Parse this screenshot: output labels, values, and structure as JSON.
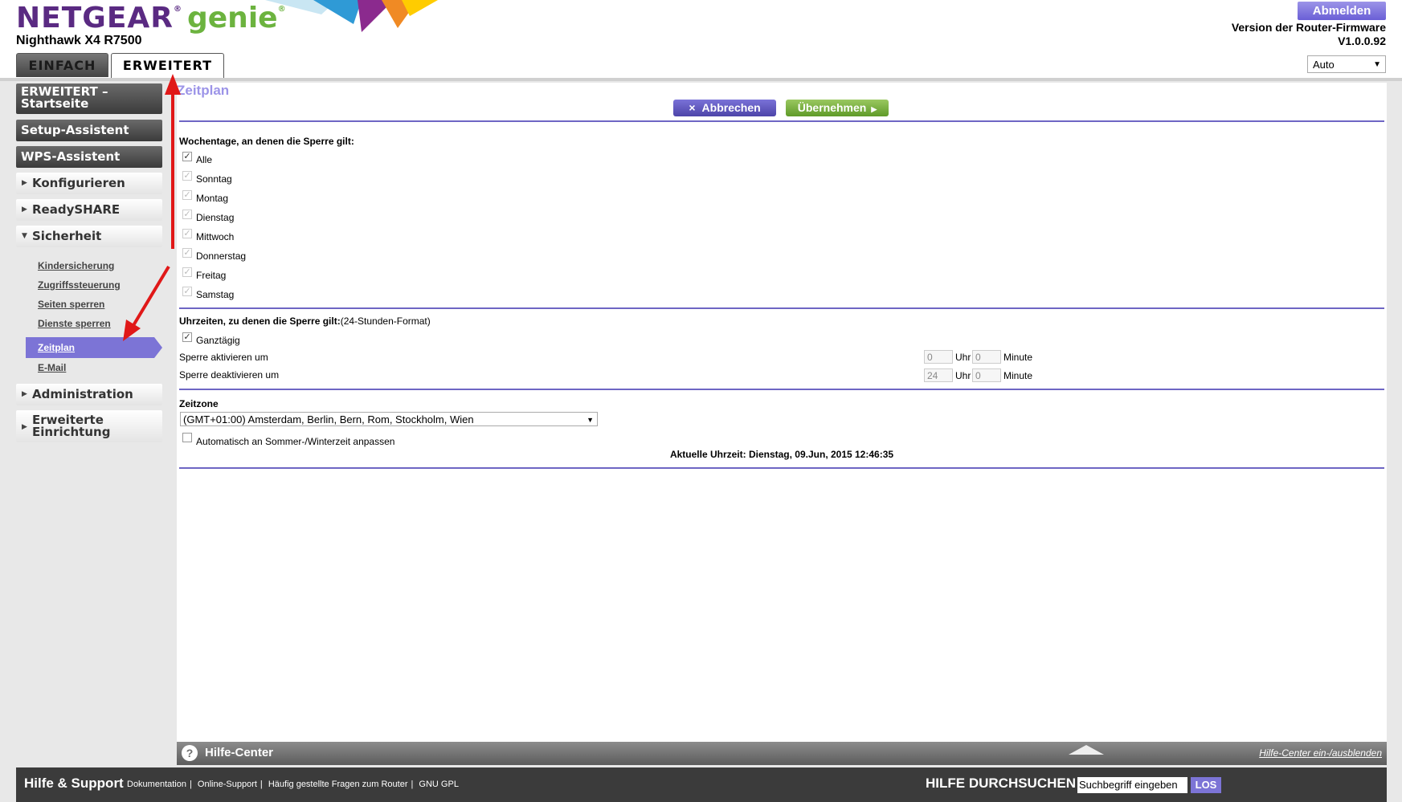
{
  "header": {
    "brand": "NETGEAR",
    "brand_sub": "genie",
    "model": "Nighthawk X4 R7500",
    "logout_label": "Abmelden",
    "firmware_label": "Version der Router-Firmware",
    "firmware_version": "V1.0.0.92",
    "language": "Auto",
    "tabs": [
      {
        "label": "EINFACH",
        "active": false
      },
      {
        "label": "ERWEITERT",
        "active": true
      }
    ]
  },
  "sidebar": {
    "dark_items": [
      {
        "label_line1": "ERWEITERT –",
        "label_line2": "Startseite"
      },
      {
        "label": "Setup-Assistent"
      },
      {
        "label": "WPS-Assistent"
      }
    ],
    "sections": [
      {
        "label": "Konfigurieren",
        "expanded": false
      },
      {
        "label": "ReadySHARE",
        "expanded": false
      },
      {
        "label": "Sicherheit",
        "expanded": true
      },
      {
        "label": "Administration",
        "expanded": false
      },
      {
        "label_line1": "Erweiterte",
        "label_line2": "Einrichtung",
        "expanded": false
      }
    ],
    "security_links": [
      "Kindersicherung",
      "Zugriffssteuerung",
      "Seiten sperren",
      "Dienste sperren",
      "Zeitplan",
      "E-Mail"
    ],
    "active_link": "Zeitplan"
  },
  "content": {
    "title": "Zeitplan",
    "cancel_label": "Abbrechen",
    "apply_label": "Übernehmen",
    "days_heading": "Wochentage, an denen die Sperre gilt:",
    "days": [
      {
        "label": "Alle",
        "checked": true,
        "enabled": true
      },
      {
        "label": "Sonntag",
        "checked": true,
        "enabled": false
      },
      {
        "label": "Montag",
        "checked": true,
        "enabled": false
      },
      {
        "label": "Dienstag",
        "checked": true,
        "enabled": false
      },
      {
        "label": "Mittwoch",
        "checked": true,
        "enabled": false
      },
      {
        "label": "Donnerstag",
        "checked": true,
        "enabled": false
      },
      {
        "label": "Freitag",
        "checked": true,
        "enabled": false
      },
      {
        "label": "Samstag",
        "checked": true,
        "enabled": false
      }
    ],
    "times_heading": "Uhrzeiten, zu denen die Sperre gilt:",
    "times_format": "(24-Stunden-Format)",
    "all_day_label": "Ganztägig",
    "all_day_checked": true,
    "start_label": "Sperre aktivieren um",
    "end_label": "Sperre deaktivieren um",
    "start_hour": "0",
    "start_minute": "0",
    "end_hour": "24",
    "end_minute": "0",
    "hour_unit": "Uhr",
    "minute_unit": "Minute",
    "timezone_heading": "Zeitzone",
    "timezone_value": "(GMT+01:00) Amsterdam, Berlin, Bern, Rom, Stockholm, Wien",
    "dst_label": "Automatisch an Sommer-/Winterzeit anpassen",
    "dst_checked": false,
    "current_time": "Aktuelle Uhrzeit: Dienstag, 09.Jun, 2015 12:46:35"
  },
  "help_center": {
    "title": "Hilfe-Center",
    "toggle_label": "Hilfe-Center ein-/ausblenden"
  },
  "footer": {
    "title": "Hilfe & Support",
    "links": [
      "Dokumentation",
      "Online-Support",
      "Häufig gestellte Fragen zum Router",
      "GNU GPL"
    ],
    "search_label": "HILFE DURCHSUCHEN",
    "search_placeholder": "Suchbegriff eingeben",
    "search_button": "LOS"
  },
  "colors": {
    "brand_purple": "#5a2a82",
    "genie_green": "#6cb33f",
    "accent_purple": "#7c74d6",
    "apply_green": "#6fa935",
    "annotation_red": "#e01818"
  }
}
